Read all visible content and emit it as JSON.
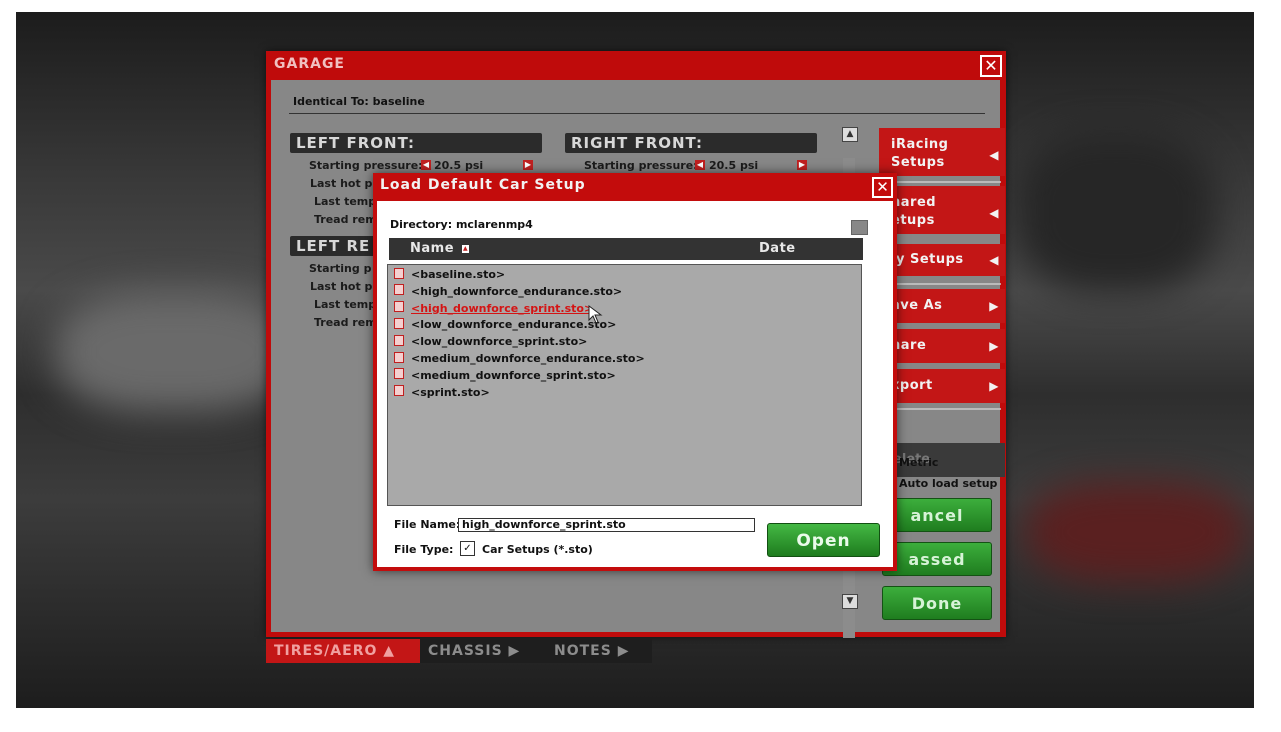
{
  "garage": {
    "title": "GARAGE",
    "close": "✕",
    "identical_to": "Identical To: baseline",
    "left_front": {
      "header": "LEFT FRONT:",
      "starting_pressure_label": "Starting pressure:",
      "starting_pressure_value": "20.5 psi",
      "last_hot_label": "Last hot pr",
      "last_temp_label": "Last temp",
      "tread_label": "Tread rem"
    },
    "right_front": {
      "header": "RIGHT FRONT:",
      "starting_pressure_label": "Starting pressure:",
      "starting_pressure_value": "20.5 psi"
    },
    "left_rear": {
      "header": "LEFT RE",
      "starting_label": "Starting p",
      "last_hot_label": "Last hot pr",
      "last_temp_label": "Last temp",
      "tread_label": "Tread rem"
    },
    "side_buttons": {
      "iracing_setups": [
        "iRacing",
        "Setups"
      ],
      "shared_setups": [
        "hared",
        "etups"
      ],
      "my_setups": "ly Setups",
      "save_as": "ave As",
      "share": "hare",
      "export": "xport",
      "delete": "elete",
      "arrow_left": "◀",
      "arrow_right": "▶"
    },
    "options": {
      "metric": "Metric",
      "auto_load": "Auto load setup"
    },
    "buttons": {
      "cancel": "ancel",
      "passed": "assed",
      "done": "Done"
    },
    "tabs": {
      "tires_aero": "TIRES/AERO ▲",
      "chassis": "CHASSIS ▶",
      "notes": "NOTES ▶"
    },
    "scroll_up": "▲",
    "scroll_down": "▼"
  },
  "dialog": {
    "title": "Load Default Car Setup",
    "close": "✕",
    "directory": "Directory: mclarenmp4",
    "columns": {
      "name": "Name",
      "name_sort_indicator": "▲",
      "date": "Date"
    },
    "files": [
      "<baseline.sto>",
      "<high_downforce_endurance.sto>",
      "<high_downforce_sprint.sto>",
      "<low_downforce_endurance.sto>",
      "<low_downforce_sprint.sto>",
      "<medium_downforce_endurance.sto>",
      "<medium_downforce_sprint.sto>",
      "<sprint.sto>"
    ],
    "selected_file_index": 2,
    "file_name_label": "File Name:",
    "file_name_value": "high_downforce_sprint.sto",
    "file_type_label": "File Type:",
    "file_type_check": "✓",
    "file_type_value": "Car Setups (*.sto)",
    "open_button": "Open"
  },
  "colors": {
    "panel_red": "#bf0b0b",
    "selected_text_red": "#d41414",
    "green_button": "#2e9a2e"
  }
}
